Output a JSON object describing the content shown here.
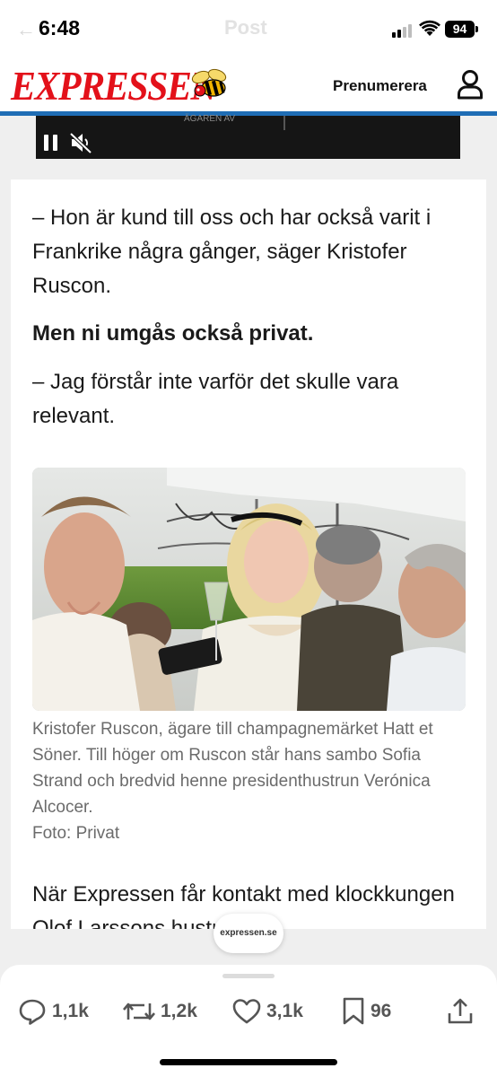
{
  "status_bar": {
    "time": "6:48",
    "ghost_title": "Post",
    "battery": "94",
    "icons": [
      "signal-icon",
      "wifi-icon",
      "battery-icon"
    ]
  },
  "site_header": {
    "logo_text": "EXPRESSEN",
    "subscribe_label": "Prenumerera",
    "brand_color": "#e3111a",
    "accent_rule_color": "#1f6db5",
    "icons": [
      "wasp-logo-icon",
      "user-icon"
    ]
  },
  "video": {
    "caption_fragment": "ÄGAREN AV",
    "icons": [
      "pause-icon",
      "mute-icon"
    ]
  },
  "article": {
    "paragraph_1": "– Hon är kund till oss och har också varit i Frankrike några gånger, säger Kristofer Ruscon.",
    "question": "Men ni umgås också privat.",
    "paragraph_2": "– Jag förstår inte varför det skulle vara relevant.",
    "photo_caption": "Kristofer Ruscon, ägare till champagnemärket Hatt et Söner. Till höger om Ruscon står hans sambo Sofia Strand och bredvid henne presidenthustrun Verónica Alcocer.",
    "photo_credit": "Foto: Privat",
    "paragraph_3": "När Expressen får kontakt med klockkungen Olof Larssons hustru"
  },
  "domain_pill": "expressen.se",
  "actions": {
    "replies": "1,1k",
    "reposts": "1,2k",
    "likes": "3,1k",
    "bookmarks": "96",
    "icons": [
      "reply-icon",
      "repost-icon",
      "like-icon",
      "bookmark-icon",
      "share-icon"
    ]
  }
}
